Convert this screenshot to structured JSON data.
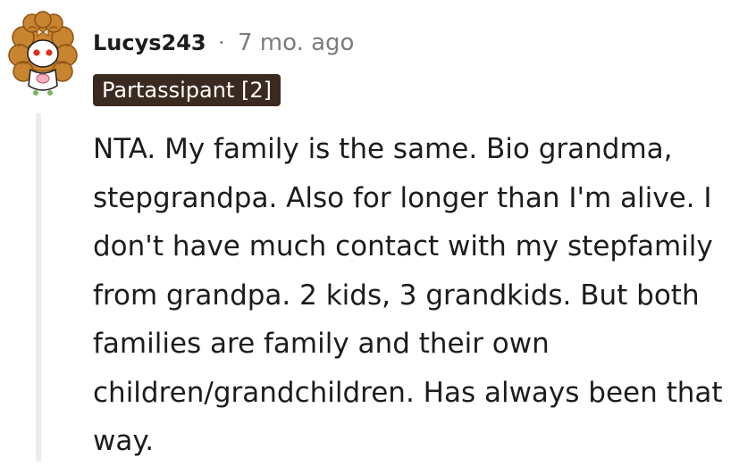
{
  "comment": {
    "author": "Lucys243",
    "separator": "·",
    "timestamp": "7 mo. ago",
    "flair": "Partassipant [2]",
    "body": "NTA. My family is the same. Bio grandma, stepgrandpa. Also for longer than I'm alive. I don't have much contact with my stepfamily from grandpa. 2 kids, 3 grandkids. But both families are family and their own children/grandchildren. Has always been that way."
  },
  "colors": {
    "flair_bg": "#3b2a1f",
    "meta_gray": "#7c7c7c",
    "thread_line": "#ececec",
    "hair": "#c8842e",
    "eyes": "#e0301e"
  },
  "icons": {
    "avatar": "snoo-avatar-curly-hair"
  }
}
